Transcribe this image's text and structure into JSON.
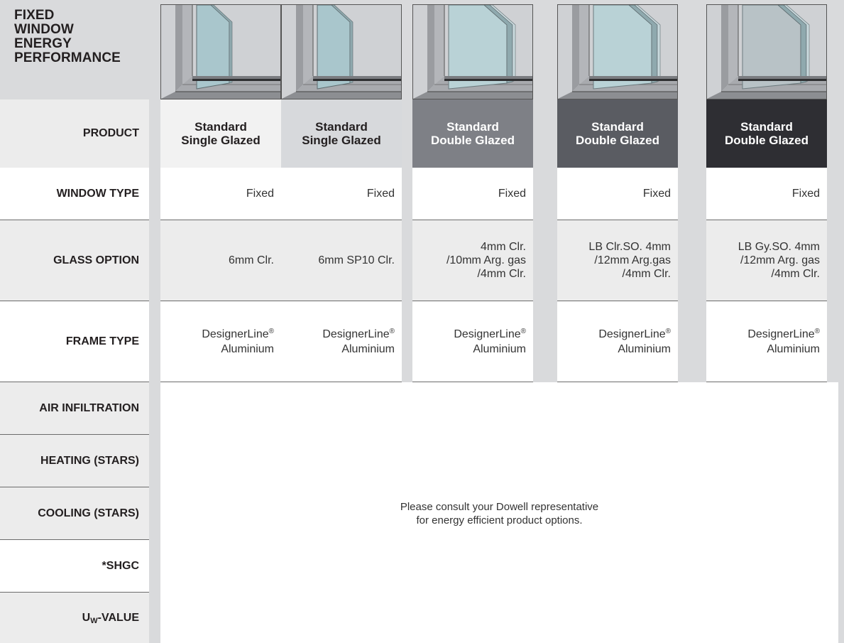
{
  "title_lines": [
    "FIXED",
    "WINDOW",
    "ENERGY",
    "PERFORMANCE"
  ],
  "row_labels": {
    "product": "PRODUCT",
    "window_type": "WINDOW TYPE",
    "glass_option": "GLASS OPTION",
    "frame_type": "FRAME TYPE",
    "air_infiltration": "AIR INFILTRATION",
    "heating": "HEATING (STARS)",
    "cooling": "COOLING (STARS)",
    "shgc": "*SHGC",
    "uw_prefix": "U",
    "uw_sub": "W",
    "uw_suffix": "-VALUE"
  },
  "products": [
    {
      "name_line1": "Standard",
      "name_line2": "Single Glazed",
      "header_bg": "#f2f2f2",
      "header_fg": "#231f20",
      "window_type": "Fixed",
      "glass_lines": [
        "6mm Clr."
      ],
      "frame_line1": "DesignerLine",
      "frame_reg": "®",
      "frame_line2": "Aluminium"
    },
    {
      "name_line1": "Standard",
      "name_line2": "Single Glazed",
      "header_bg": "#d7d9dc",
      "header_fg": "#231f20",
      "window_type": "Fixed",
      "glass_lines": [
        "6mm SP10 Clr."
      ],
      "frame_line1": "DesignerLine",
      "frame_reg": "®",
      "frame_line2": "Aluminium"
    },
    {
      "name_line1": "Standard",
      "name_line2": "Double Glazed",
      "header_bg": "#7e8086",
      "header_fg": "#ffffff",
      "window_type": "Fixed",
      "glass_lines": [
        "4mm Clr.",
        "/10mm Arg. gas",
        "/4mm Clr."
      ],
      "frame_line1": "DesignerLine",
      "frame_reg": "®",
      "frame_line2": "Aluminium"
    },
    {
      "name_line1": "Standard",
      "name_line2": "Double Glazed",
      "header_bg": "#5a5c62",
      "header_fg": "#ffffff",
      "window_type": "Fixed",
      "glass_lines": [
        "LB Clr.SO. 4mm",
        "/12mm Arg.gas",
        "/4mm Clr."
      ],
      "frame_line1": "DesignerLine",
      "frame_reg": "®",
      "frame_line2": "Aluminium"
    },
    {
      "name_line1": "Standard",
      "name_line2": "Double Glazed",
      "header_bg": "#2e2e33",
      "header_fg": "#ffffff",
      "window_type": "Fixed",
      "glass_lines": [
        "LB Gy.SO. 4mm",
        "/12mm Arg. gas",
        "/4mm Clr."
      ],
      "frame_line1": "DesignerLine",
      "frame_reg": "®",
      "frame_line2": "Aluminium"
    }
  ],
  "note_line1": "Please consult your Dowell representative",
  "note_line2": "for energy efficient product options.",
  "colors": {
    "background": "#d9dadc",
    "row_white": "#ffffff",
    "row_grey": "#ececec",
    "single_glass": "#a9c6cc",
    "double_glass": "#b9d2d6",
    "tinted_glass": "#b8c2c6"
  }
}
